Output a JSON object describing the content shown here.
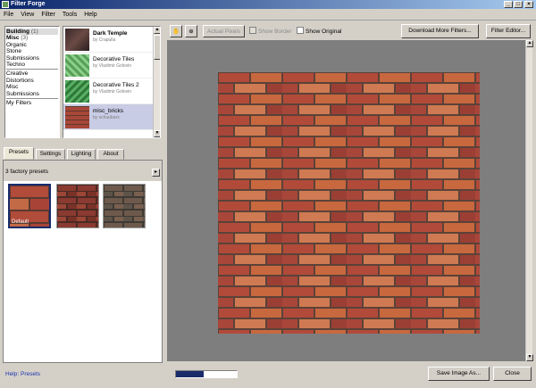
{
  "window": {
    "title": "Filter Forge"
  },
  "menu": [
    "File",
    "View",
    "Filter",
    "Tools",
    "Help"
  ],
  "categories": [
    {
      "label": "Building",
      "count": "(1)",
      "selected": true
    },
    {
      "label": "Misc",
      "count": "(3)",
      "bold": true
    },
    {
      "label": "Organic"
    },
    {
      "label": "Stone"
    },
    {
      "label": "Submissions"
    },
    {
      "label": "Techno"
    },
    {
      "separator": true
    },
    {
      "label": "Creative"
    },
    {
      "label": "Distortions"
    },
    {
      "label": "Misc"
    },
    {
      "label": "Submissions"
    },
    {
      "separator": true
    },
    {
      "label": "My Filters"
    }
  ],
  "filters": [
    {
      "name": "Dark Temple",
      "author": "by Crapulla",
      "bold": true,
      "thumb": "dark"
    },
    {
      "name": "Decorative Tiles",
      "author": "by Vladimir Golovin",
      "thumb": "tiles1"
    },
    {
      "name": "Decorative Tiles 2",
      "author": "by Vladimir Golovin",
      "thumb": "tiles2"
    },
    {
      "name": "misc_bricks",
      "author": "by schuubarx",
      "selected": true,
      "thumb": "bricks"
    }
  ],
  "tabs": [
    "Presets",
    "Settings",
    "Lighting",
    "About"
  ],
  "presets": {
    "header": "3 factory presets",
    "default_label": "Default"
  },
  "help_link": "Help: Presets",
  "toolbar": {
    "actual_pixels": "Actual Pixels",
    "show_border": "Show Border",
    "show_original": "Show Original",
    "download_more": "Download More Filters...",
    "filter_editor": "Filter Editor..."
  },
  "footer": {
    "save_image": "Save Image As...",
    "close": "Close",
    "progress": 0.45
  },
  "colors": {
    "title_start": "#0a246a",
    "title_end": "#a6caf0",
    "selection": "#c8cce4",
    "accent": "#1a2b6b"
  }
}
